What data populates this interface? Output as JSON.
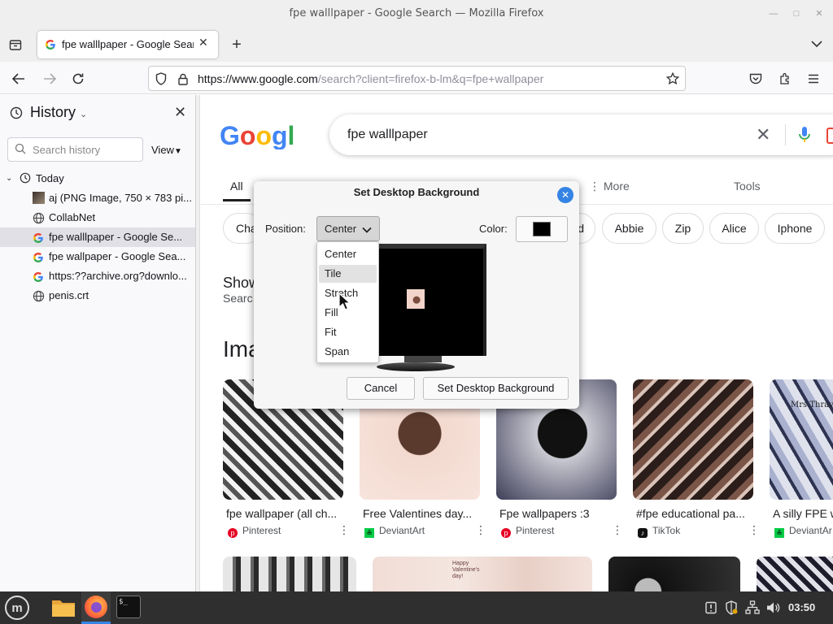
{
  "window": {
    "title": "fpe walllpaper - Google Search — Mozilla Firefox"
  },
  "tab": {
    "title": "fpe walllpaper - Google Search"
  },
  "urlbar": {
    "host": "https://www.google.com",
    "path": "/search?client=firefox-b-lm&q=fpe+wallpaper"
  },
  "sidebar": {
    "title": "History",
    "search_placeholder": "Search history",
    "view_label": "View",
    "group": "Today",
    "items": [
      {
        "label": "aj (PNG Image, 750 × 783 pi..."
      },
      {
        "label": "CollabNet"
      },
      {
        "label": "fpe walllpaper - Google Se..."
      },
      {
        "label": "fpe wallpaper - Google Sea..."
      },
      {
        "label": "https:??archive.org?downlo..."
      },
      {
        "label": "penis.crt"
      }
    ]
  },
  "google": {
    "query": "fpe walllpaper",
    "tabs": {
      "all": "All",
      "more": "More",
      "tools": "Tools"
    },
    "chips": [
      "Cha",
      "d",
      "Abbie",
      "Zip",
      "Alice",
      "Iphone"
    ],
    "showing": "Show",
    "search_fragment": "Searc",
    "images_heading": "Ima",
    "results": [
      {
        "caption": "fpe wallpaper (all ch...",
        "source": "Pinterest"
      },
      {
        "caption": "Free Valentines day...",
        "source": "DeviantArt"
      },
      {
        "caption": "Fpe wallpapers :3",
        "source": "Pinterest"
      },
      {
        "caption": "#fpe educational pa...",
        "source": "TikTok"
      },
      {
        "caption": "A silly FPE w",
        "source": "DeviantAr"
      }
    ],
    "tile_text_1": "Mrs.Thravel",
    "tile_text_2": "Happy\nValentine's\nday!"
  },
  "dialog": {
    "title": "Set Desktop Background",
    "position_label": "Position:",
    "position_value": "Center",
    "color_label": "Color:",
    "color_value": "#000000",
    "cancel": "Cancel",
    "confirm": "Set Desktop Background",
    "options": [
      "Center",
      "Tile",
      "Stretch",
      "Fill",
      "Fit",
      "Span"
    ],
    "highlighted_option": "Tile"
  },
  "taskbar": {
    "clock": "03:50"
  },
  "colors": {
    "accent": "#3584e4",
    "google_blue": "#4285f4",
    "taskbar": "#2f2f2f"
  }
}
